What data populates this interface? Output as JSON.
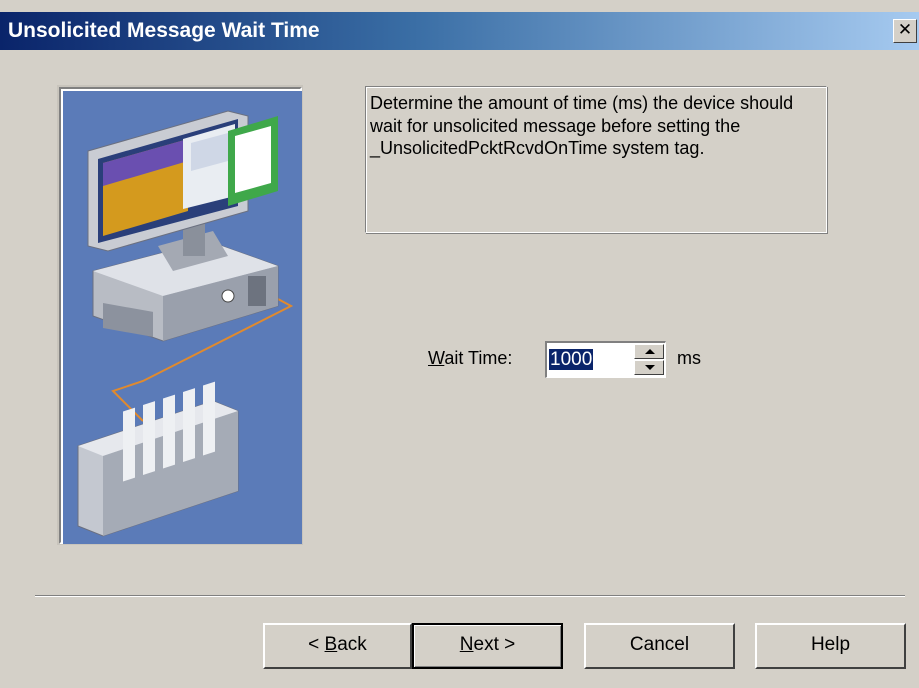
{
  "window": {
    "title": "Unsolicited Message Wait Time",
    "close_glyph": "✕"
  },
  "description": "Determine the amount of time (ms) the device should wait for unsolicited message before setting the _UnsolicitedPcktRcvdOnTime system tag.",
  "wait_time": {
    "label_mnemonic": "W",
    "label_rest": "ait Time:",
    "value": "1000",
    "unit": "ms"
  },
  "buttons": {
    "back_prefix": "< ",
    "back_mnemonic": "B",
    "back_rest": "ack",
    "next_mnemonic": "N",
    "next_rest": "ext >",
    "cancel": "Cancel",
    "help": "Help"
  },
  "icons": {
    "illustration": "computer-connected-to-device",
    "spin_up": "arrow-up-icon",
    "spin_down": "arrow-down-icon"
  },
  "colors": {
    "title_gradient_start": "#0a246a",
    "title_gradient_end": "#a6caf0",
    "illustration_background": "#5b7bb8",
    "selection": "#0a246a"
  }
}
